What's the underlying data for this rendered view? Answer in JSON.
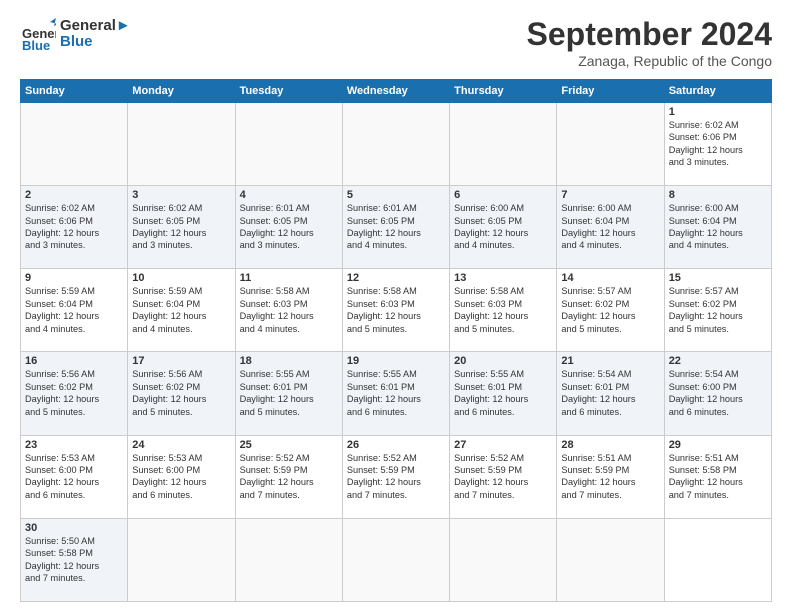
{
  "header": {
    "logo_general": "General",
    "logo_blue": "Blue",
    "month": "September 2024",
    "location": "Zanaga, Republic of the Congo"
  },
  "weekdays": [
    "Sunday",
    "Monday",
    "Tuesday",
    "Wednesday",
    "Thursday",
    "Friday",
    "Saturday"
  ],
  "days": [
    {
      "num": "",
      "info": "",
      "empty": true
    },
    {
      "num": "",
      "info": "",
      "empty": true
    },
    {
      "num": "",
      "info": "",
      "empty": true
    },
    {
      "num": "",
      "info": "",
      "empty": true
    },
    {
      "num": "",
      "info": "",
      "empty": true
    },
    {
      "num": "",
      "info": "",
      "empty": true
    },
    {
      "num": "1",
      "info": "Sunrise: 6:02 AM\nSunset: 6:06 PM\nDaylight: 12 hours\nand 3 minutes."
    },
    {
      "num": "2",
      "info": "Sunrise: 6:02 AM\nSunset: 6:06 PM\nDaylight: 12 hours\nand 3 minutes."
    },
    {
      "num": "3",
      "info": "Sunrise: 6:02 AM\nSunset: 6:05 PM\nDaylight: 12 hours\nand 3 minutes."
    },
    {
      "num": "4",
      "info": "Sunrise: 6:01 AM\nSunset: 6:05 PM\nDaylight: 12 hours\nand 3 minutes."
    },
    {
      "num": "5",
      "info": "Sunrise: 6:01 AM\nSunset: 6:05 PM\nDaylight: 12 hours\nand 4 minutes."
    },
    {
      "num": "6",
      "info": "Sunrise: 6:00 AM\nSunset: 6:05 PM\nDaylight: 12 hours\nand 4 minutes."
    },
    {
      "num": "7",
      "info": "Sunrise: 6:00 AM\nSunset: 6:04 PM\nDaylight: 12 hours\nand 4 minutes."
    },
    {
      "num": "8",
      "info": "Sunrise: 6:00 AM\nSunset: 6:04 PM\nDaylight: 12 hours\nand 4 minutes."
    },
    {
      "num": "9",
      "info": "Sunrise: 5:59 AM\nSunset: 6:04 PM\nDaylight: 12 hours\nand 4 minutes."
    },
    {
      "num": "10",
      "info": "Sunrise: 5:59 AM\nSunset: 6:04 PM\nDaylight: 12 hours\nand 4 minutes."
    },
    {
      "num": "11",
      "info": "Sunrise: 5:58 AM\nSunset: 6:03 PM\nDaylight: 12 hours\nand 4 minutes."
    },
    {
      "num": "12",
      "info": "Sunrise: 5:58 AM\nSunset: 6:03 PM\nDaylight: 12 hours\nand 5 minutes."
    },
    {
      "num": "13",
      "info": "Sunrise: 5:58 AM\nSunset: 6:03 PM\nDaylight: 12 hours\nand 5 minutes."
    },
    {
      "num": "14",
      "info": "Sunrise: 5:57 AM\nSunset: 6:02 PM\nDaylight: 12 hours\nand 5 minutes."
    },
    {
      "num": "15",
      "info": "Sunrise: 5:57 AM\nSunset: 6:02 PM\nDaylight: 12 hours\nand 5 minutes."
    },
    {
      "num": "16",
      "info": "Sunrise: 5:56 AM\nSunset: 6:02 PM\nDaylight: 12 hours\nand 5 minutes."
    },
    {
      "num": "17",
      "info": "Sunrise: 5:56 AM\nSunset: 6:02 PM\nDaylight: 12 hours\nand 5 minutes."
    },
    {
      "num": "18",
      "info": "Sunrise: 5:55 AM\nSunset: 6:01 PM\nDaylight: 12 hours\nand 5 minutes."
    },
    {
      "num": "19",
      "info": "Sunrise: 5:55 AM\nSunset: 6:01 PM\nDaylight: 12 hours\nand 6 minutes."
    },
    {
      "num": "20",
      "info": "Sunrise: 5:55 AM\nSunset: 6:01 PM\nDaylight: 12 hours\nand 6 minutes."
    },
    {
      "num": "21",
      "info": "Sunrise: 5:54 AM\nSunset: 6:01 PM\nDaylight: 12 hours\nand 6 minutes."
    },
    {
      "num": "22",
      "info": "Sunrise: 5:54 AM\nSunset: 6:00 PM\nDaylight: 12 hours\nand 6 minutes."
    },
    {
      "num": "23",
      "info": "Sunrise: 5:53 AM\nSunset: 6:00 PM\nDaylight: 12 hours\nand 6 minutes."
    },
    {
      "num": "24",
      "info": "Sunrise: 5:53 AM\nSunset: 6:00 PM\nDaylight: 12 hours\nand 6 minutes."
    },
    {
      "num": "25",
      "info": "Sunrise: 5:52 AM\nSunset: 5:59 PM\nDaylight: 12 hours\nand 7 minutes."
    },
    {
      "num": "26",
      "info": "Sunrise: 5:52 AM\nSunset: 5:59 PM\nDaylight: 12 hours\nand 7 minutes."
    },
    {
      "num": "27",
      "info": "Sunrise: 5:52 AM\nSunset: 5:59 PM\nDaylight: 12 hours\nand 7 minutes."
    },
    {
      "num": "28",
      "info": "Sunrise: 5:51 AM\nSunset: 5:59 PM\nDaylight: 12 hours\nand 7 minutes."
    },
    {
      "num": "29",
      "info": "Sunrise: 5:51 AM\nSunset: 5:58 PM\nDaylight: 12 hours\nand 7 minutes."
    },
    {
      "num": "30",
      "info": "Sunrise: 5:50 AM\nSunset: 5:58 PM\nDaylight: 12 hours\nand 7 minutes."
    },
    {
      "num": "",
      "info": "",
      "empty": true
    },
    {
      "num": "",
      "info": "",
      "empty": true
    },
    {
      "num": "",
      "info": "",
      "empty": true
    },
    {
      "num": "",
      "info": "",
      "empty": true
    },
    {
      "num": "",
      "info": "",
      "empty": true
    }
  ]
}
